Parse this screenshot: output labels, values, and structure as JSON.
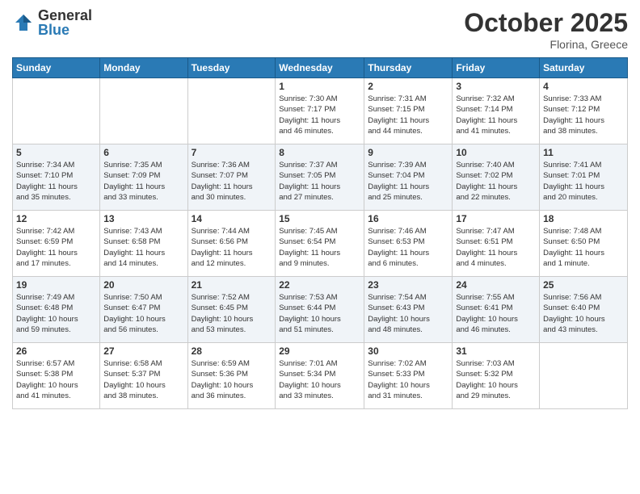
{
  "header": {
    "logo_general": "General",
    "logo_blue": "Blue",
    "month": "October 2025",
    "location": "Florina, Greece"
  },
  "weekdays": [
    "Sunday",
    "Monday",
    "Tuesday",
    "Wednesday",
    "Thursday",
    "Friday",
    "Saturday"
  ],
  "weeks": [
    [
      {
        "day": "",
        "info": ""
      },
      {
        "day": "",
        "info": ""
      },
      {
        "day": "",
        "info": ""
      },
      {
        "day": "1",
        "info": "Sunrise: 7:30 AM\nSunset: 7:17 PM\nDaylight: 11 hours\nand 46 minutes."
      },
      {
        "day": "2",
        "info": "Sunrise: 7:31 AM\nSunset: 7:15 PM\nDaylight: 11 hours\nand 44 minutes."
      },
      {
        "day": "3",
        "info": "Sunrise: 7:32 AM\nSunset: 7:14 PM\nDaylight: 11 hours\nand 41 minutes."
      },
      {
        "day": "4",
        "info": "Sunrise: 7:33 AM\nSunset: 7:12 PM\nDaylight: 11 hours\nand 38 minutes."
      }
    ],
    [
      {
        "day": "5",
        "info": "Sunrise: 7:34 AM\nSunset: 7:10 PM\nDaylight: 11 hours\nand 35 minutes."
      },
      {
        "day": "6",
        "info": "Sunrise: 7:35 AM\nSunset: 7:09 PM\nDaylight: 11 hours\nand 33 minutes."
      },
      {
        "day": "7",
        "info": "Sunrise: 7:36 AM\nSunset: 7:07 PM\nDaylight: 11 hours\nand 30 minutes."
      },
      {
        "day": "8",
        "info": "Sunrise: 7:37 AM\nSunset: 7:05 PM\nDaylight: 11 hours\nand 27 minutes."
      },
      {
        "day": "9",
        "info": "Sunrise: 7:39 AM\nSunset: 7:04 PM\nDaylight: 11 hours\nand 25 minutes."
      },
      {
        "day": "10",
        "info": "Sunrise: 7:40 AM\nSunset: 7:02 PM\nDaylight: 11 hours\nand 22 minutes."
      },
      {
        "day": "11",
        "info": "Sunrise: 7:41 AM\nSunset: 7:01 PM\nDaylight: 11 hours\nand 20 minutes."
      }
    ],
    [
      {
        "day": "12",
        "info": "Sunrise: 7:42 AM\nSunset: 6:59 PM\nDaylight: 11 hours\nand 17 minutes."
      },
      {
        "day": "13",
        "info": "Sunrise: 7:43 AM\nSunset: 6:58 PM\nDaylight: 11 hours\nand 14 minutes."
      },
      {
        "day": "14",
        "info": "Sunrise: 7:44 AM\nSunset: 6:56 PM\nDaylight: 11 hours\nand 12 minutes."
      },
      {
        "day": "15",
        "info": "Sunrise: 7:45 AM\nSunset: 6:54 PM\nDaylight: 11 hours\nand 9 minutes."
      },
      {
        "day": "16",
        "info": "Sunrise: 7:46 AM\nSunset: 6:53 PM\nDaylight: 11 hours\nand 6 minutes."
      },
      {
        "day": "17",
        "info": "Sunrise: 7:47 AM\nSunset: 6:51 PM\nDaylight: 11 hours\nand 4 minutes."
      },
      {
        "day": "18",
        "info": "Sunrise: 7:48 AM\nSunset: 6:50 PM\nDaylight: 11 hours\nand 1 minute."
      }
    ],
    [
      {
        "day": "19",
        "info": "Sunrise: 7:49 AM\nSunset: 6:48 PM\nDaylight: 10 hours\nand 59 minutes."
      },
      {
        "day": "20",
        "info": "Sunrise: 7:50 AM\nSunset: 6:47 PM\nDaylight: 10 hours\nand 56 minutes."
      },
      {
        "day": "21",
        "info": "Sunrise: 7:52 AM\nSunset: 6:45 PM\nDaylight: 10 hours\nand 53 minutes."
      },
      {
        "day": "22",
        "info": "Sunrise: 7:53 AM\nSunset: 6:44 PM\nDaylight: 10 hours\nand 51 minutes."
      },
      {
        "day": "23",
        "info": "Sunrise: 7:54 AM\nSunset: 6:43 PM\nDaylight: 10 hours\nand 48 minutes."
      },
      {
        "day": "24",
        "info": "Sunrise: 7:55 AM\nSunset: 6:41 PM\nDaylight: 10 hours\nand 46 minutes."
      },
      {
        "day": "25",
        "info": "Sunrise: 7:56 AM\nSunset: 6:40 PM\nDaylight: 10 hours\nand 43 minutes."
      }
    ],
    [
      {
        "day": "26",
        "info": "Sunrise: 6:57 AM\nSunset: 5:38 PM\nDaylight: 10 hours\nand 41 minutes."
      },
      {
        "day": "27",
        "info": "Sunrise: 6:58 AM\nSunset: 5:37 PM\nDaylight: 10 hours\nand 38 minutes."
      },
      {
        "day": "28",
        "info": "Sunrise: 6:59 AM\nSunset: 5:36 PM\nDaylight: 10 hours\nand 36 minutes."
      },
      {
        "day": "29",
        "info": "Sunrise: 7:01 AM\nSunset: 5:34 PM\nDaylight: 10 hours\nand 33 minutes."
      },
      {
        "day": "30",
        "info": "Sunrise: 7:02 AM\nSunset: 5:33 PM\nDaylight: 10 hours\nand 31 minutes."
      },
      {
        "day": "31",
        "info": "Sunrise: 7:03 AM\nSunset: 5:32 PM\nDaylight: 10 hours\nand 29 minutes."
      },
      {
        "day": "",
        "info": ""
      }
    ]
  ]
}
